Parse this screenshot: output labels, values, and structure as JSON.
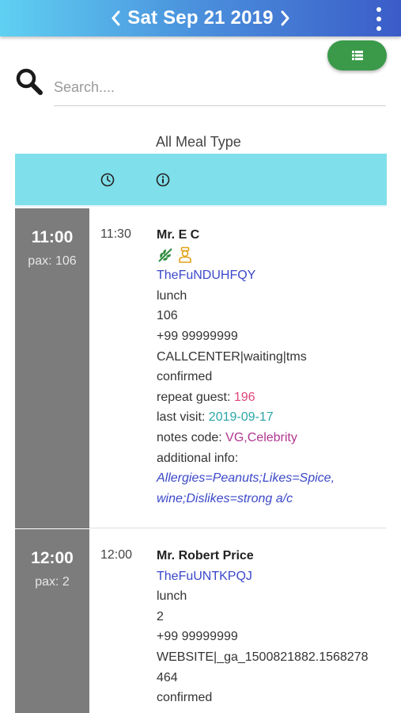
{
  "header": {
    "date": "Sat Sep 21 2019",
    "prev_icon": "chevron-left-icon",
    "next_icon": "chevron-right-icon",
    "menu_icon": "more-vertical-icon",
    "accent_start": "#5fd0f2",
    "accent_end": "#3b5cc8"
  },
  "list_button": {
    "icon": "list-icon",
    "color": "#3a9a4a"
  },
  "search": {
    "placeholder": "Search....",
    "value": "",
    "icon": "search-icon"
  },
  "filter": {
    "meal_type": "All Meal Type"
  },
  "table": {
    "header_color": "#7fdfea",
    "header_icons": [
      "clock-icon",
      "info-icon"
    ]
  },
  "slots": [
    {
      "time": "11:00",
      "pax": "pax: 106",
      "reservations": [
        {
          "time": "11:30",
          "name": "Mr. E C",
          "icons": [
            "vegetarian-leaf-icon",
            "celebrity-person-icon"
          ],
          "code": "TheFuNDUHFQY",
          "meal": "lunch",
          "pax": "106",
          "phone": "+99 99999999",
          "source": "CALLCENTER|waiting|tms",
          "status": "confirmed",
          "repeat_label": "repeat guest: ",
          "repeat_value": "196",
          "visit_label": "last visit: ",
          "visit_value": "2019-09-17",
          "notes_label": "notes code: ",
          "notes_value": "VG,Celebrity",
          "additional_label": "additional info:",
          "additional_line1": "Allergies=Peanuts;Likes=Spice,",
          "additional_line2": "wine;Dislikes=strong a/c"
        }
      ]
    },
    {
      "time": "12:00",
      "pax": "pax: 2",
      "reservations": [
        {
          "time": "12:00",
          "name": "Mr. Robert Price",
          "code": "TheFuUNTKPQJ",
          "meal": "lunch",
          "pax": "2",
          "phone": "+99 99999999",
          "source_line1": "WEBSITE|_ga_1500821882.1568278",
          "source_line2": "464",
          "status": "confirmed"
        }
      ]
    }
  ]
}
